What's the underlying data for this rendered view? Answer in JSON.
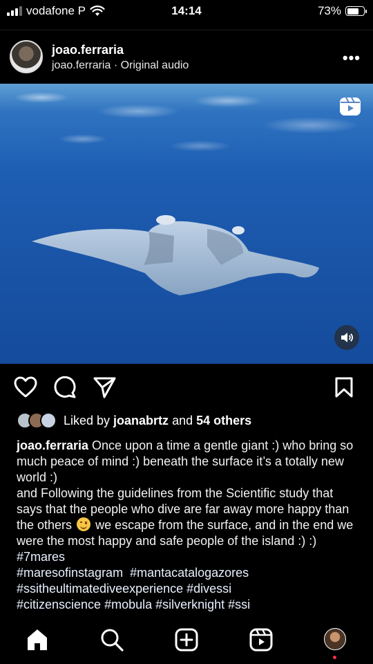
{
  "status_bar": {
    "carrier": "vodafone P",
    "time": "14:14",
    "battery": "73%",
    "battery_level": 0.73
  },
  "post": {
    "username": "joao.ferraria",
    "subtitle": "joao.ferraria · Original audio",
    "more_icon": "more-horizontal-icon"
  },
  "media": {
    "description_icon": "reels-icon",
    "sound_icon": "speaker-icon"
  },
  "actions": {
    "like_icon": "heart-icon",
    "comment_icon": "comment-icon",
    "share_icon": "share-icon",
    "save_icon": "bookmark-icon"
  },
  "likes": {
    "prefix": "Liked by ",
    "user": "joanabrtz",
    "middle": " and ",
    "others": "54 others"
  },
  "caption": {
    "username": "joao.ferraria",
    "line1_text": " Once upon a time a gentle giant :) who bring so much peace of mind :) beneath the surface it’s a totally new world :)",
    "line2_before_emoji": "and Following the guidelines from the Scientific study that says that the people who dive are far away more happy than the others ",
    "line2_after_emoji": " we escape from the surface, and in the end we were the most happy and safe people of the island :) :) ",
    "hashtags_1": "#7mares",
    "hashtags_2": "#maresofinstagram  #mantacatalogazores",
    "hashtags_3": "#ssitheultimatediveexperience #divessi",
    "hashtags_4": "#citizenscience #mobula #silverknight #ssi"
  },
  "bottom_nav": {
    "items": [
      "home-icon",
      "search-icon",
      "create-icon",
      "reels-icon",
      "profile-avatar"
    ]
  }
}
